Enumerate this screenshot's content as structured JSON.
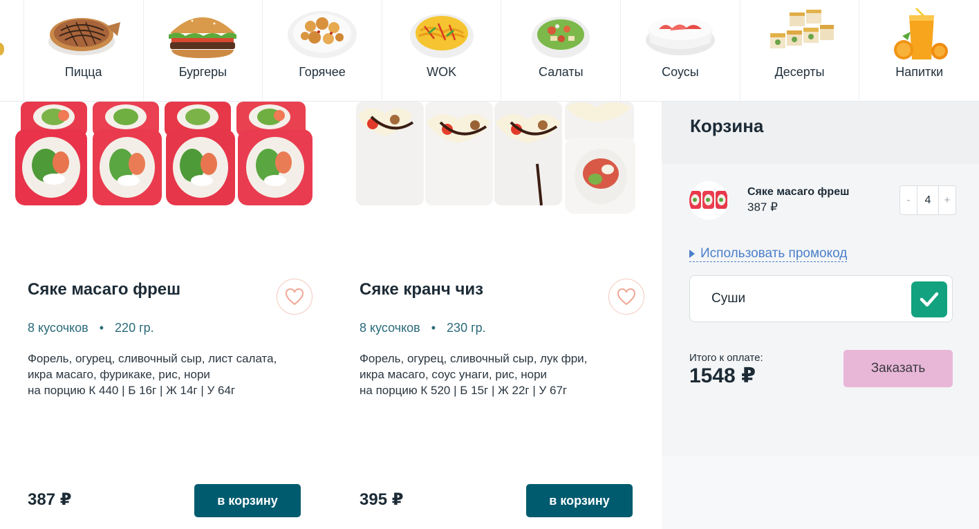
{
  "categories": [
    {
      "label": "Пицца",
      "icon": "pizza-icon"
    },
    {
      "label": "Бургеры",
      "icon": "burger-icon"
    },
    {
      "label": "Горячее",
      "icon": "hot-dish-icon"
    },
    {
      "label": "WOK",
      "icon": "wok-icon"
    },
    {
      "label": "Салаты",
      "icon": "salad-icon"
    },
    {
      "label": "Соусы",
      "icon": "sauce-icon"
    },
    {
      "label": "Десерты",
      "icon": "dessert-icon"
    },
    {
      "label": "Напитки",
      "icon": "drink-icon"
    }
  ],
  "products": [
    {
      "title": "Сяке масаго фреш",
      "pieces": "8 кусочков",
      "weight": "220  гр.",
      "desc": [
        "Форель, огурец, сливочный сыр, лист салата,",
        "икра масаго, фурикаке, рис, нори",
        "на порцию К 440 | Б 16г | Ж 14г | У 64г"
      ],
      "price": "387 ₽",
      "cart_label": "в корзину"
    },
    {
      "title": "Сяке кранч чиз",
      "pieces": "8 кусочков",
      "weight": "230  гр.",
      "desc": [
        "Форель, огурец, сливочный сыр, лук фри,",
        "икра масаго, соус унаги, рис, нори",
        "на порцию К 520 | Б 15г | Ж 22г | У 67г"
      ],
      "price": "395 ₽",
      "cart_label": "в корзину"
    }
  ],
  "basket": {
    "title": "Корзина",
    "item": {
      "name": "Сяке масаго фреш",
      "price": "387 ₽",
      "qty": "4",
      "minus": "-",
      "plus": "+"
    },
    "promo_link": "Использовать промокод",
    "promo_value": "Суши",
    "total_label": "Итого к оплате:",
    "total_value": "1548 ₽",
    "order_label": "Заказать"
  },
  "colors": {
    "accent": "#005b6f",
    "check": "#12a27f",
    "order": "#e8b7d8",
    "link": "#4a7fc9"
  }
}
